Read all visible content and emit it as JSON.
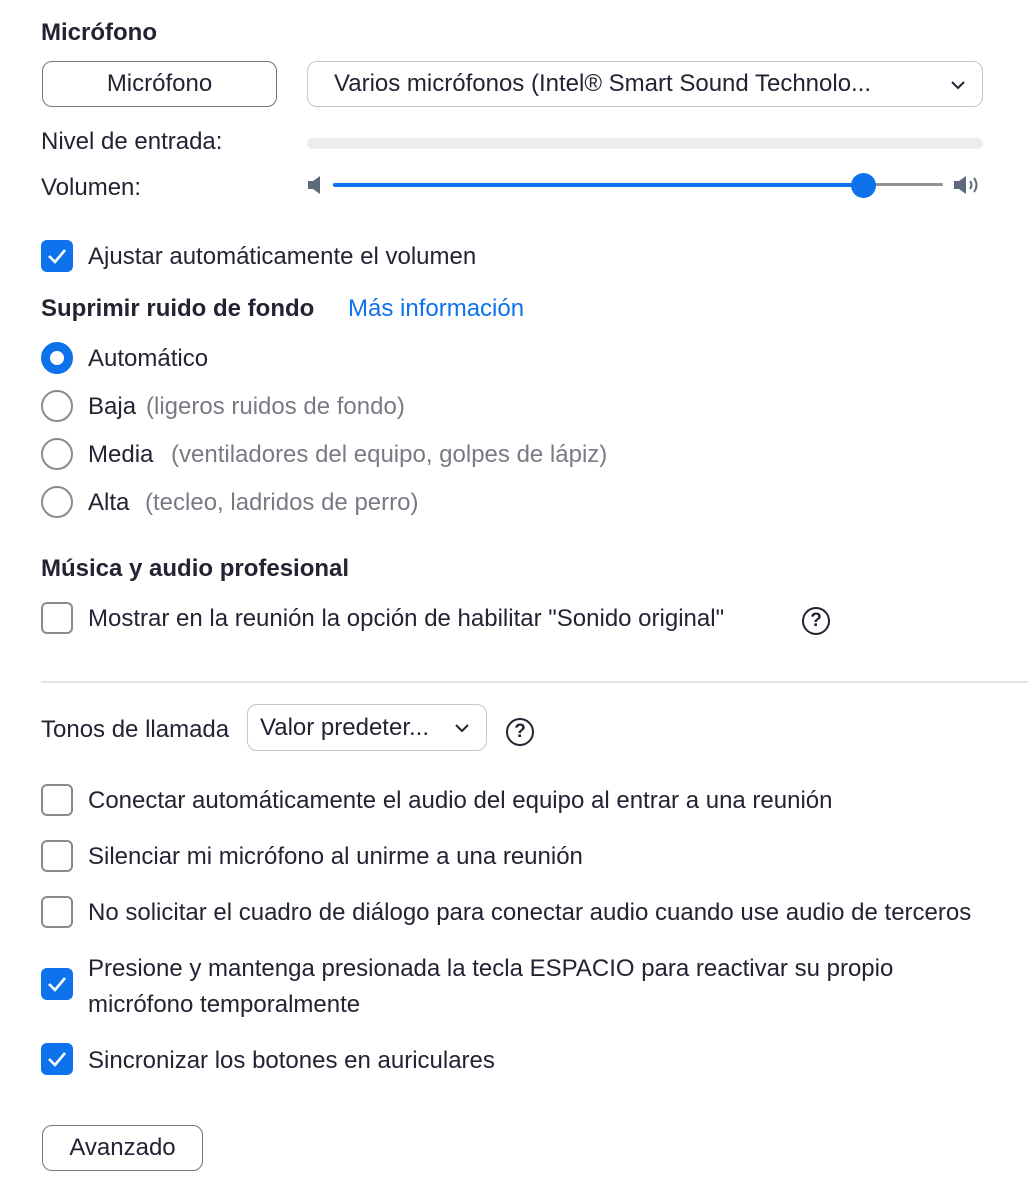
{
  "microphone": {
    "heading": "Micrófono",
    "test_button": "Micrófono",
    "device_select": "Varios micrófonos (Intel® Smart Sound Technolo...",
    "input_level_label": "Nivel de entrada:",
    "input_level": 0,
    "volume_label": "Volumen:",
    "volume": 0.87,
    "auto_adjust_label": "Ajustar automáticamente el volumen",
    "auto_adjust_checked": true
  },
  "noise": {
    "heading": "Suprimir ruido de fondo",
    "more_info": "Más información",
    "options": [
      {
        "label": "Automático",
        "hint": "",
        "checked": true
      },
      {
        "label": "Baja",
        "hint": "(ligeros ruidos de fondo)",
        "checked": false
      },
      {
        "label": "Media",
        "hint": "(ventiladores del equipo, golpes de lápiz)",
        "checked": false
      },
      {
        "label": "Alta",
        "hint": "(tecleo, ladridos de perro)",
        "checked": false
      }
    ]
  },
  "music": {
    "heading": "Música y audio profesional",
    "original_sound_label": "Mostrar en la reunión la opción de habilitar \"Sonido original\"",
    "original_sound_checked": false
  },
  "ringtone": {
    "label": "Tonos de llamada",
    "select": "Valor predeter..."
  },
  "options": [
    {
      "label": "Conectar automáticamente el audio del equipo al entrar a una reunión",
      "checked": false
    },
    {
      "label": "Silenciar mi micrófono al unirme a una reunión",
      "checked": false
    },
    {
      "label": "No solicitar el cuadro de diálogo para conectar audio cuando use audio de terceros",
      "checked": false
    },
    {
      "label_line1": "Presione y mantenga presionada la tecla ESPACIO para reactivar su propio",
      "label_line2": "micrófono temporalmente",
      "checked": true
    },
    {
      "label": "Sincronizar los botones en auriculares",
      "checked": true
    }
  ],
  "advanced_button": "Avanzado",
  "colors": {
    "accent": "#0e72ed",
    "text": "#232333",
    "muted": "#7a7a85"
  }
}
